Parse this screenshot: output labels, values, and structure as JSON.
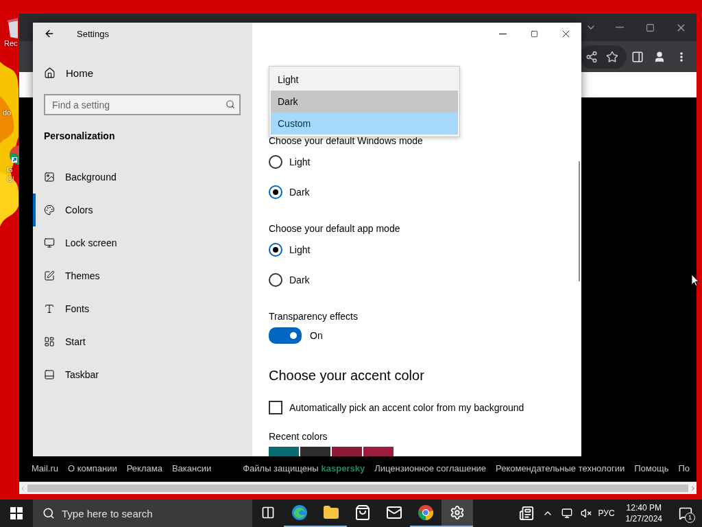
{
  "desktop": {
    "icons": [
      {
        "kind": "bin",
        "label": [
          "Rec"
        ]
      },
      {
        "kind": "folder",
        "label": [
          "do"
        ]
      },
      {
        "kind": "browser",
        "label": [
          "G",
          "Cl"
        ]
      }
    ]
  },
  "browser": {
    "footer_left": [
      "Mail.ru",
      "О компании",
      "Реклама",
      "Вакансии"
    ],
    "protection": {
      "text": "Файлы защищены",
      "brand": "kaspersky"
    },
    "footer_right": [
      "Лицензионное соглашение",
      "Рекомендательные технологии",
      "Помощь",
      "По"
    ]
  },
  "settings": {
    "title": "Settings",
    "home": "Home",
    "search": {
      "placeholder": "Find a setting"
    },
    "section": "Personalization",
    "nav": [
      {
        "kind": "background",
        "label": "Background",
        "selected": false
      },
      {
        "kind": "colors",
        "label": "Colors",
        "selected": true
      },
      {
        "kind": "lock",
        "label": "Lock screen",
        "selected": false
      },
      {
        "kind": "themes",
        "label": "Themes",
        "selected": false
      },
      {
        "kind": "fonts",
        "label": "Fonts",
        "selected": false
      },
      {
        "kind": "start",
        "label": "Start",
        "selected": false
      },
      {
        "kind": "taskbar",
        "label": "Taskbar",
        "selected": false
      }
    ],
    "dropdown": {
      "options": [
        {
          "label": "Light",
          "hovered": false,
          "selected": false
        },
        {
          "label": "Dark",
          "hovered": true,
          "selected": false
        },
        {
          "label": "Custom",
          "hovered": false,
          "selected": true
        }
      ]
    },
    "windows_mode": {
      "label": "Choose your default Windows mode",
      "options": [
        {
          "label": "Light",
          "selected": false
        },
        {
          "label": "Dark",
          "selected": true
        }
      ]
    },
    "app_mode": {
      "label": "Choose your default app mode",
      "options": [
        {
          "label": "Light",
          "selected": true
        },
        {
          "label": "Dark",
          "selected": false
        }
      ]
    },
    "transparency": {
      "label": "Transparency effects",
      "on": true,
      "state": "On"
    },
    "accent_heading": "Choose your accent color",
    "auto_accent": {
      "label": "Automatically pick an accent color from my background",
      "checked": false
    },
    "recent_colors": {
      "label": "Recent colors",
      "swatches": [
        {
          "color": "#0a6b73"
        },
        {
          "color": "#2d2d2d"
        },
        {
          "color": "#8c1b38"
        },
        {
          "color": "#9b1d3e"
        }
      ]
    }
  },
  "taskbar": {
    "search": {
      "placeholder": "Type here to search"
    },
    "apps": [
      {
        "kind": "taskview",
        "running": false,
        "selected": false
      },
      {
        "kind": "edge",
        "running": true,
        "selected": false
      },
      {
        "kind": "explorer",
        "running": true,
        "selected": false
      },
      {
        "kind": "store",
        "running": false,
        "selected": false
      },
      {
        "kind": "mail",
        "running": false,
        "selected": false
      },
      {
        "kind": "chrome",
        "running": true,
        "selected": false
      },
      {
        "kind": "settings",
        "running": true,
        "selected": true
      }
    ],
    "language": "РУС",
    "time": "12:40 PM",
    "date": "1/27/2024",
    "notifications": "1"
  }
}
